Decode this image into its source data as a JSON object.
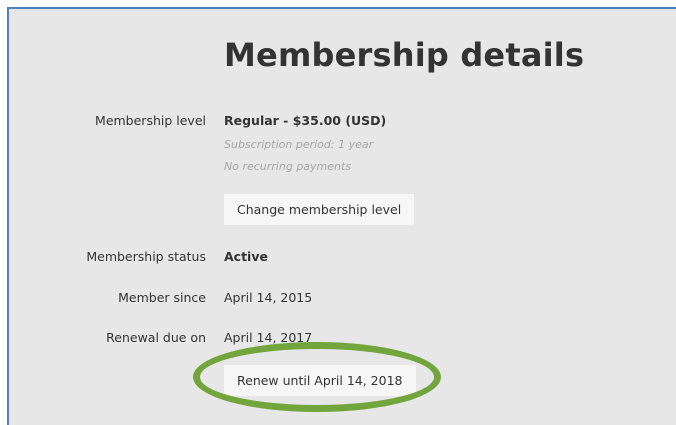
{
  "page": {
    "title": "Membership details"
  },
  "membership": {
    "level_label": "Membership level",
    "level_value": "Regular - $35.00 (USD)",
    "subscription_period": "Subscription period: 1 year",
    "recurring_note": "No recurring payments",
    "change_level_button": "Change membership level",
    "status_label": "Membership status",
    "status_value": "Active",
    "since_label": "Member since",
    "since_value": "April 14, 2015",
    "renewal_label": "Renewal due on",
    "renewal_value": "April 14, 2017",
    "renew_button": "Renew until April 14, 2018"
  },
  "colors": {
    "panel_background": "#e7e7e7",
    "panel_border": "#4f81bd",
    "highlight_ring": "#72a53c"
  }
}
